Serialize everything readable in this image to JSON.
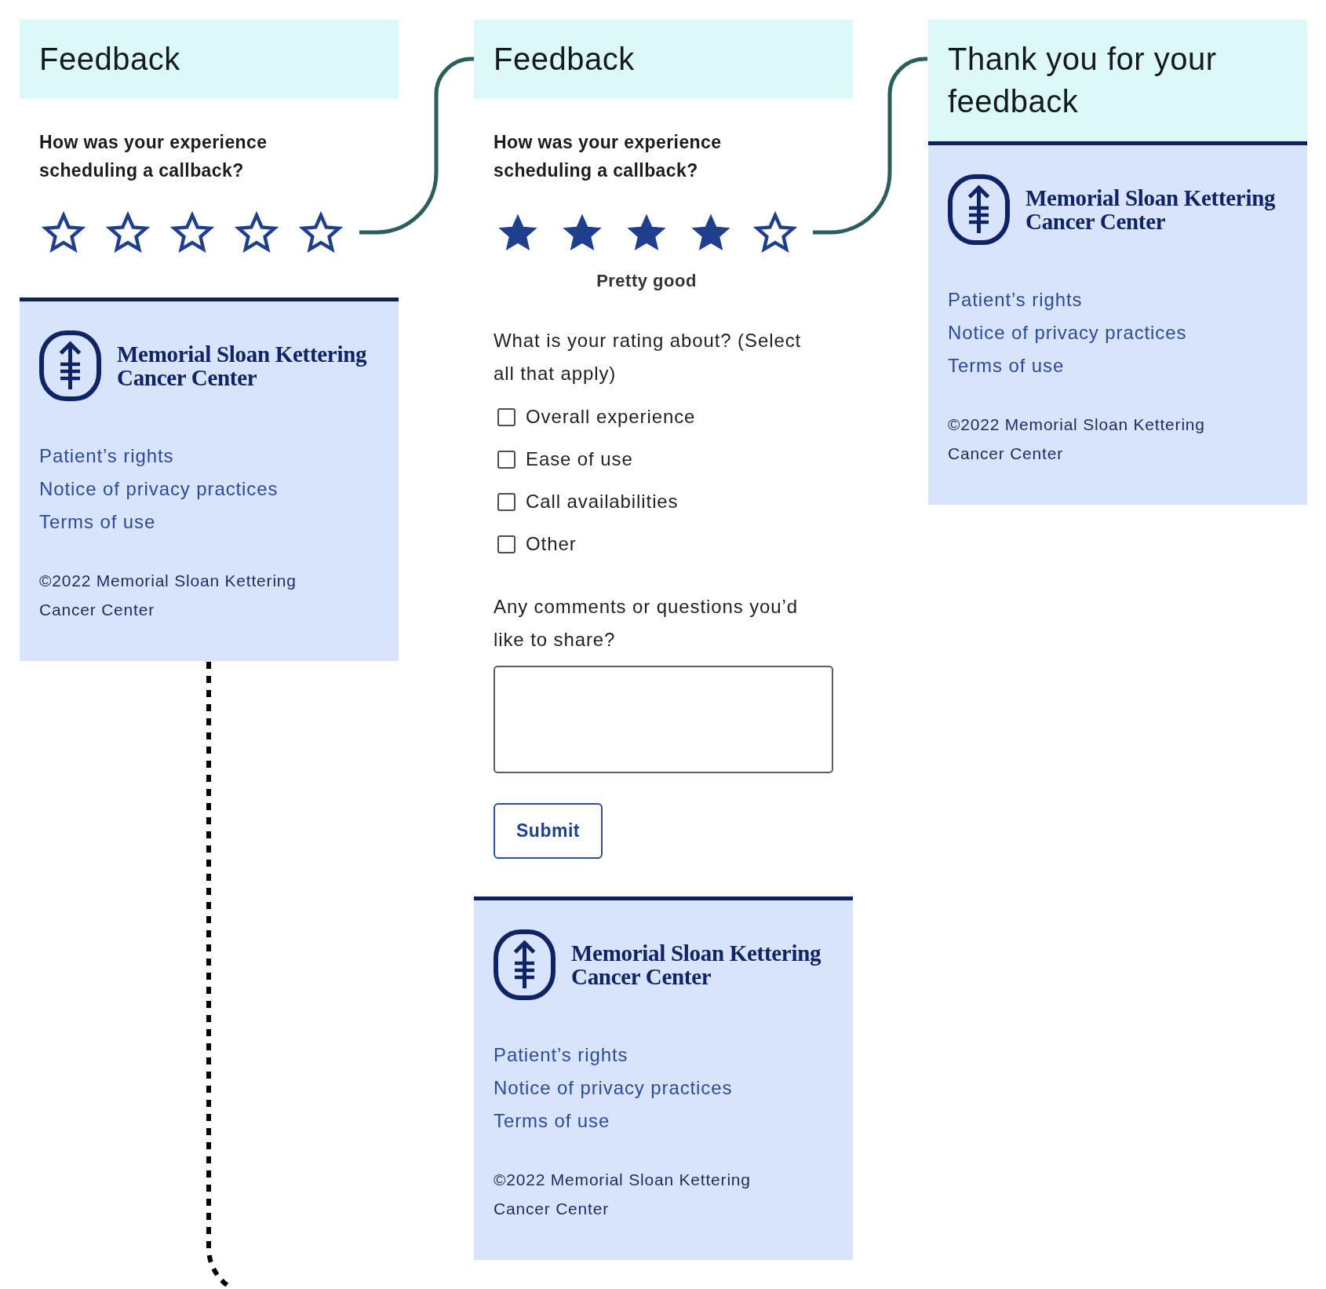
{
  "screens": [
    {
      "kind": "rating",
      "title": "Feedback",
      "question": "How was your experience scheduling a callback?",
      "stars": 0,
      "footer": {
        "logo_text": "Memorial Sloan Kettering Cancer Center",
        "links": [
          "Patient’s rights",
          "Notice of privacy practices",
          "Terms of use"
        ],
        "copyright": "©2022 Memorial Sloan Kettering Cancer Center"
      }
    },
    {
      "kind": "form",
      "title": "Feedback",
      "question": "How was your experience scheduling a callback?",
      "stars": 4,
      "rating_caption": "Pretty good",
      "topics_label": "What is your rating about? (Select all that apply)",
      "topics": [
        {
          "label": "Overall experience",
          "checked": false
        },
        {
          "label": "Ease of use",
          "checked": false
        },
        {
          "label": "Call availabilities",
          "checked": false
        },
        {
          "label": "Other",
          "checked": false
        }
      ],
      "comments_label": "Any comments or questions you’d like to share?",
      "submit": "Submit",
      "footer": {
        "logo_text": "Memorial Sloan Kettering Cancer Center",
        "links": [
          "Patient’s rights",
          "Notice of privacy practices",
          "Terms of use"
        ],
        "copyright": "©2022 Memorial Sloan Kettering Cancer Center"
      }
    },
    {
      "kind": "confirmation",
      "title": "Thank you for your feedback",
      "footer": {
        "logo_text": "Memorial Sloan Kettering Cancer Center",
        "links": [
          "Patient’s rights",
          "Notice of privacy practices",
          "Terms of use"
        ],
        "copyright": "©2022 Memorial Sloan Kettering Cancer Center"
      }
    }
  ]
}
